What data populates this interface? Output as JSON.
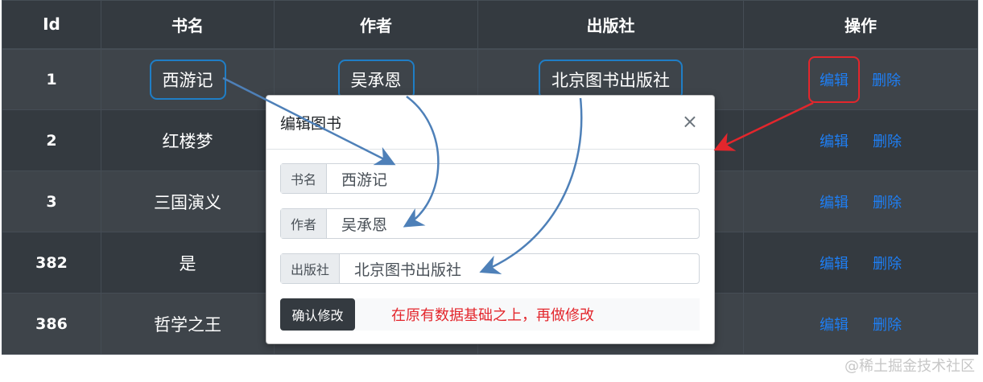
{
  "table": {
    "headers": [
      "Id",
      "书名",
      "作者",
      "出版社",
      "操作"
    ],
    "rows": [
      {
        "id": "1",
        "name": "西游记",
        "author": "吴承恩",
        "publisher": "北京图书出版社",
        "edit": "编辑",
        "delete": "删除"
      },
      {
        "id": "2",
        "name": "红楼梦",
        "author": "",
        "publisher": "",
        "edit": "编辑",
        "delete": "删除"
      },
      {
        "id": "3",
        "name": "三国演义",
        "author": "",
        "publisher": "",
        "edit": "编辑",
        "delete": "删除"
      },
      {
        "id": "382",
        "name": "是",
        "author": "",
        "publisher": "",
        "edit": "编辑",
        "delete": "删除"
      },
      {
        "id": "386",
        "name": "哲学之王",
        "author": "",
        "publisher": "",
        "edit": "编辑",
        "delete": "删除"
      }
    ]
  },
  "modal": {
    "title": "编辑图书",
    "close": "×",
    "fields": [
      {
        "label": "书名",
        "value": "西游记"
      },
      {
        "label": "作者",
        "value": "吴承恩"
      },
      {
        "label": "出版社",
        "value": "北京图书出版社"
      }
    ],
    "confirm_label": "确认修改",
    "note": "在原有数据基础之上，再做修改"
  },
  "annotation_colors": {
    "arrow_blue": "#4e80b8",
    "arrow_red": "#e3262c",
    "link_blue": "#1e7ff5"
  },
  "watermark": "@稀土掘金技术社区"
}
